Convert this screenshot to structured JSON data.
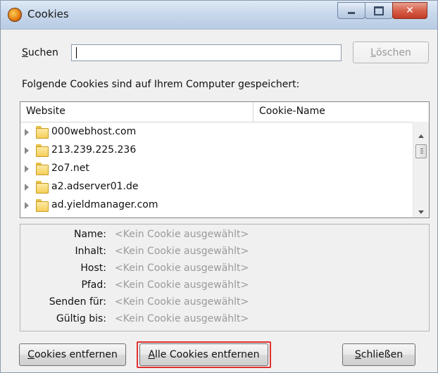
{
  "window": {
    "title": "Cookies",
    "title_icon": "firefox-icon"
  },
  "search": {
    "label_prefix": "",
    "label_accel": "S",
    "label_rest": "uchen",
    "value": "",
    "clear_button": {
      "accel": "L",
      "rest": "öschen"
    }
  },
  "info_text": "Folgende Cookies sind auf Ihrem Computer gespeichert:",
  "cookie_list": {
    "columns": [
      "Website",
      "Cookie-Name"
    ],
    "rows": [
      {
        "website": "000webhost.com",
        "cookie_name": ""
      },
      {
        "website": "213.239.225.236",
        "cookie_name": ""
      },
      {
        "website": "2o7.net",
        "cookie_name": ""
      },
      {
        "website": "a2.adserver01.de",
        "cookie_name": ""
      },
      {
        "website": "ad.yieldmanager.com",
        "cookie_name": ""
      }
    ]
  },
  "details": {
    "fields": [
      {
        "label": "Name:",
        "value": "<Kein Cookie ausgewählt>"
      },
      {
        "label": "Inhalt:",
        "value": "<Kein Cookie ausgewählt>"
      },
      {
        "label": "Host:",
        "value": "<Kein Cookie ausgewählt>"
      },
      {
        "label": "Pfad:",
        "value": "<Kein Cookie ausgewählt>"
      },
      {
        "label": "Senden für:",
        "value": "<Kein Cookie ausgewählt>"
      },
      {
        "label": "Gültig bis:",
        "value": "<Kein Cookie ausgewählt>"
      }
    ]
  },
  "buttons": {
    "remove": {
      "accel": "C",
      "rest": "ookies entfernen"
    },
    "remove_all": {
      "accel": "A",
      "rest": "lle Cookies entfernen"
    },
    "close": {
      "accel": "S",
      "rest": "chließen"
    }
  },
  "colors": {
    "highlight_border": "#e0302f",
    "folder": "#f4cf5a",
    "titlebar": "#c8d8ec"
  }
}
